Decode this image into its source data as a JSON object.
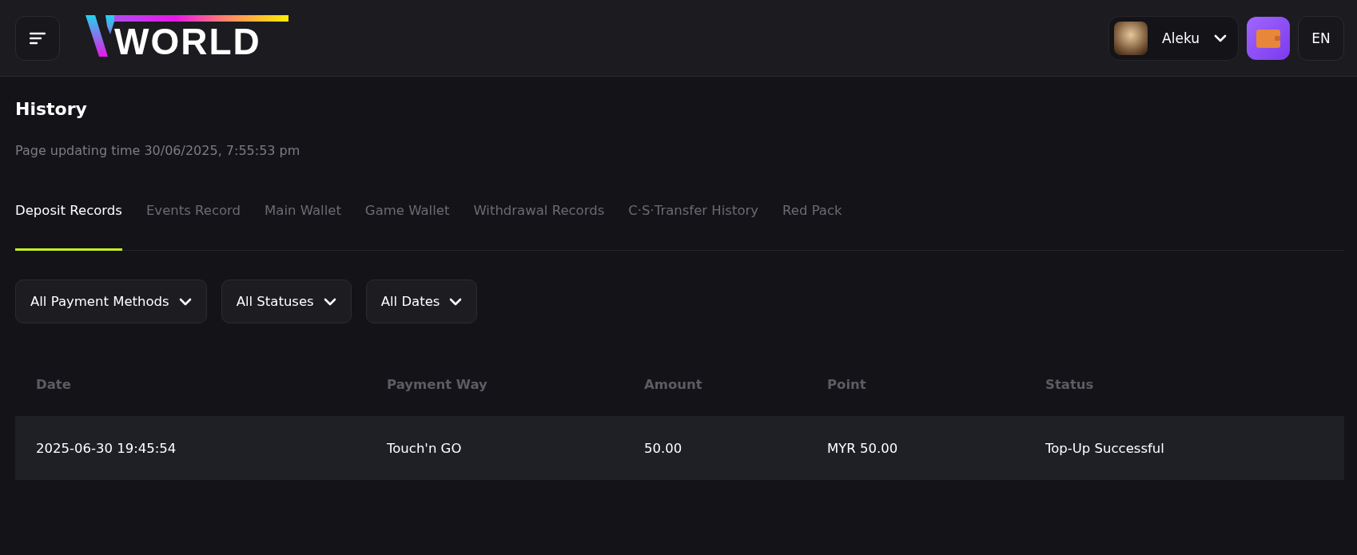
{
  "header": {
    "logo_text": "WORLD",
    "user": {
      "name": "Aleku"
    },
    "language": "EN"
  },
  "page": {
    "title": "History",
    "updated": "Page updating time 30/06/2025, 7:55:53 pm"
  },
  "tabs": [
    {
      "label": "Deposit Records",
      "selected": true
    },
    {
      "label": "Events Record",
      "selected": false
    },
    {
      "label": "Main Wallet",
      "selected": false
    },
    {
      "label": "Game Wallet",
      "selected": false
    },
    {
      "label": "Withdrawal Records",
      "selected": false
    },
    {
      "label": "C·S·Transfer History",
      "selected": false
    },
    {
      "label": "Red Pack",
      "selected": false
    }
  ],
  "filters": [
    "All Payment Methods",
    "All Statuses",
    "All Dates"
  ],
  "table": {
    "columns": [
      "Date",
      "Payment Way",
      "Amount",
      "Point",
      "Status"
    ],
    "rows": [
      [
        "2025-06-30 19:45:54",
        "Touch'n GO",
        "50.00",
        "MYR 50.00",
        "Top-Up Successful"
      ]
    ]
  }
}
